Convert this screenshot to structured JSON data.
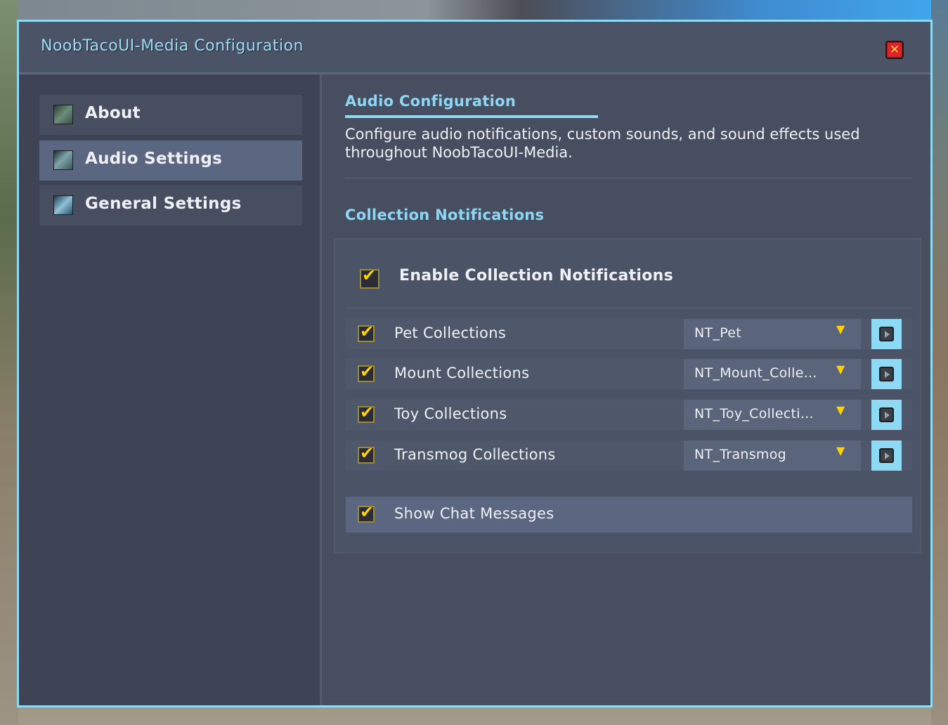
{
  "window": {
    "title": "NoobTacoUI-Media Configuration",
    "close_label": "✕"
  },
  "sidebar": {
    "items": [
      {
        "label": "About",
        "icon": "about-icon",
        "active": false
      },
      {
        "label": "Audio Settings",
        "icon": "audio-icon",
        "active": true
      },
      {
        "label": "General Settings",
        "icon": "general-icon",
        "active": false
      }
    ]
  },
  "main": {
    "section_title": "Audio Configuration",
    "description": "Configure audio notifications, custom sounds, and sound effects used throughout NoobTacoUI-Media.",
    "subsection_title": "Collection Notifications",
    "enable": {
      "label": "Enable Collection Notifications",
      "checked": true
    },
    "rows": [
      {
        "label": "Pet Collections",
        "checked": true,
        "sound": "NT_Pet"
      },
      {
        "label": "Mount Collections",
        "checked": true,
        "sound": "NT_Mount_Colle..."
      },
      {
        "label": "Toy Collections",
        "checked": true,
        "sound": "NT_Toy_Collecti..."
      },
      {
        "label": "Transmog Collections",
        "checked": true,
        "sound": "NT_Transmog"
      }
    ],
    "chat": {
      "label": "Show Chat Messages",
      "checked": true
    }
  },
  "colors": {
    "accent": "#8ed9f4",
    "title_text": "#9fdcf4",
    "check": "#ffd200",
    "close_button": "#d9242a"
  }
}
